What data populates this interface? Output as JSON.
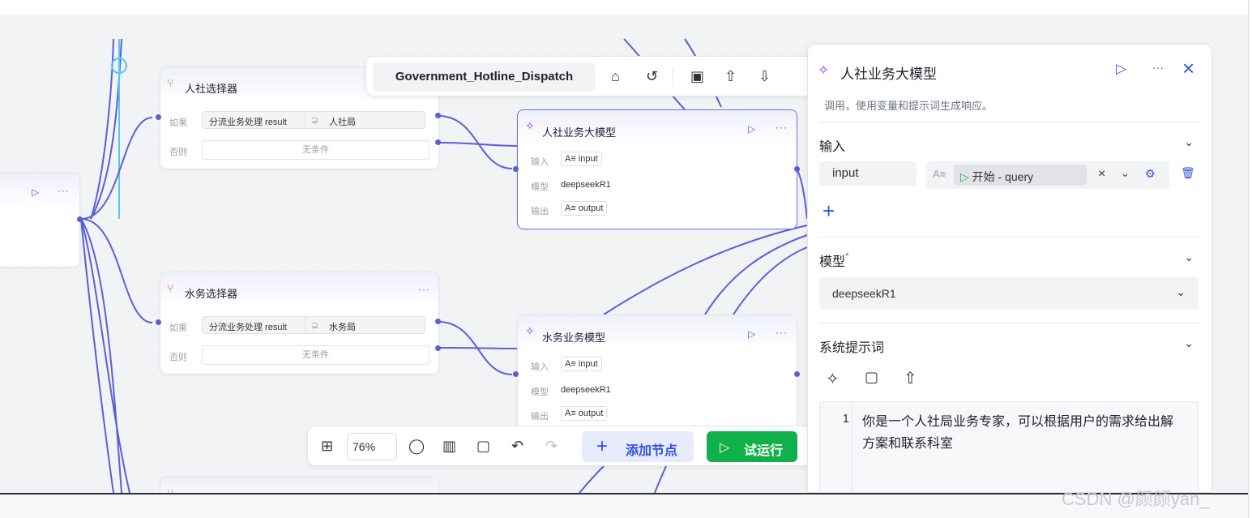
{
  "workflow_title": "Government_Hotline_Dispatch",
  "nodes": {
    "start_partial": {
      "play": "▷",
      "more": "···"
    },
    "selector_hr": {
      "title": "人社选择器",
      "if_label": "如果",
      "else_label": "否则",
      "var": "分流业务处理 result",
      "op": "⊇",
      "value": "人社局",
      "else_value": "无条件"
    },
    "selector_water": {
      "title": "水务选择器",
      "more": "···",
      "if_label": "如果",
      "else_label": "否则",
      "var": "分流业务处理 result",
      "op": "⊇",
      "value": "水务局",
      "else_value": "无条件"
    },
    "llm_hr": {
      "title": "人社业务大模型",
      "play": "▷",
      "more": "···",
      "input_label": "输入",
      "input_value": "A≡ input",
      "model_label": "模型",
      "model_value": "deepseekR1",
      "output_label": "输出",
      "output_value": "A≡ output"
    },
    "llm_water": {
      "title": "水务业务模型",
      "play": "▷",
      "more": "···",
      "input_label": "输入",
      "input_value": "A≡ input",
      "model_label": "模型",
      "model_value": "deepseekR1",
      "output_label": "输出",
      "output_value": "A≡ output"
    }
  },
  "bottom_toolbar": {
    "zoom": "76%",
    "add_node": "添加节点",
    "run": "试运行"
  },
  "panel": {
    "title": "人社业务大模型",
    "description": "调用，使用变量和提示词生成响应。",
    "input_section": "输入",
    "input_var_name": "input",
    "input_ref": "开始 - query",
    "model_section": "模型",
    "required_mark": "*",
    "model_value": "deepseekR1",
    "prompt_section": "系统提示词",
    "prompt_line_no": "1",
    "prompt_line1": "你是一个人社局业务专家，可以根据用户的需求给出解",
    "prompt_line2": "方案和联系科室"
  },
  "watermark": "CSDN @颜颜yan_",
  "colors": {
    "accent": "#4159e8",
    "edge": "#5b5fd6",
    "run_green": "#10b14a",
    "selected_border": "#6b6fe6"
  }
}
